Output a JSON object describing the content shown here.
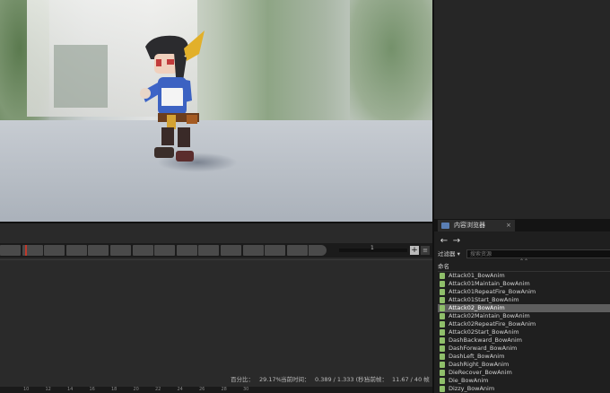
{
  "content_browser": {
    "tab_label": "内容浏览器",
    "tab_close": "×",
    "icons": {
      "tab": "content-browser-icon",
      "back": "back-arrow-icon",
      "forward": "forward-arrow-icon"
    },
    "back_glyph": "←",
    "forward_glyph": "→",
    "filter_label": "过滤器 ▾",
    "search_placeholder": "搜索资源",
    "column_header": "命名",
    "selected_index": 4,
    "assets": [
      "Attack01_BowAnim",
      "Attack01Maintain_BowAnim",
      "Attack01RepeatFire_BowAnim",
      "Attack01Start_BowAnim",
      "Attack02_BowAnim",
      "Attack02Maintain_BowAnim",
      "Attack02RepeatFire_BowAnim",
      "Attack02Start_BowAnim",
      "DashBackward_BowAnim",
      "DashForward_BowAnim",
      "DashLeft_BowAnim",
      "DashRight_BowAnim",
      "DieRecover_BowAnim",
      "Die_BowAnim",
      "Dizzy_BowAnim"
    ]
  },
  "timeline": {
    "frame_number": "1",
    "add_button": "+",
    "menu_button": "≡",
    "status": {
      "percentage_label": "百分比：",
      "percentage_value": "29.17%",
      "current_time_label": "当前时间：",
      "current_time_value": "0.389 / 1.333 (秒)",
      "current_frame_label": "当前帧：",
      "current_frame_value": "11.67 / 40 帧"
    },
    "ruler_ticks": [
      "10",
      "12",
      "14",
      "16",
      "18",
      "20",
      "22",
      "24",
      "26",
      "28",
      "30"
    ]
  }
}
